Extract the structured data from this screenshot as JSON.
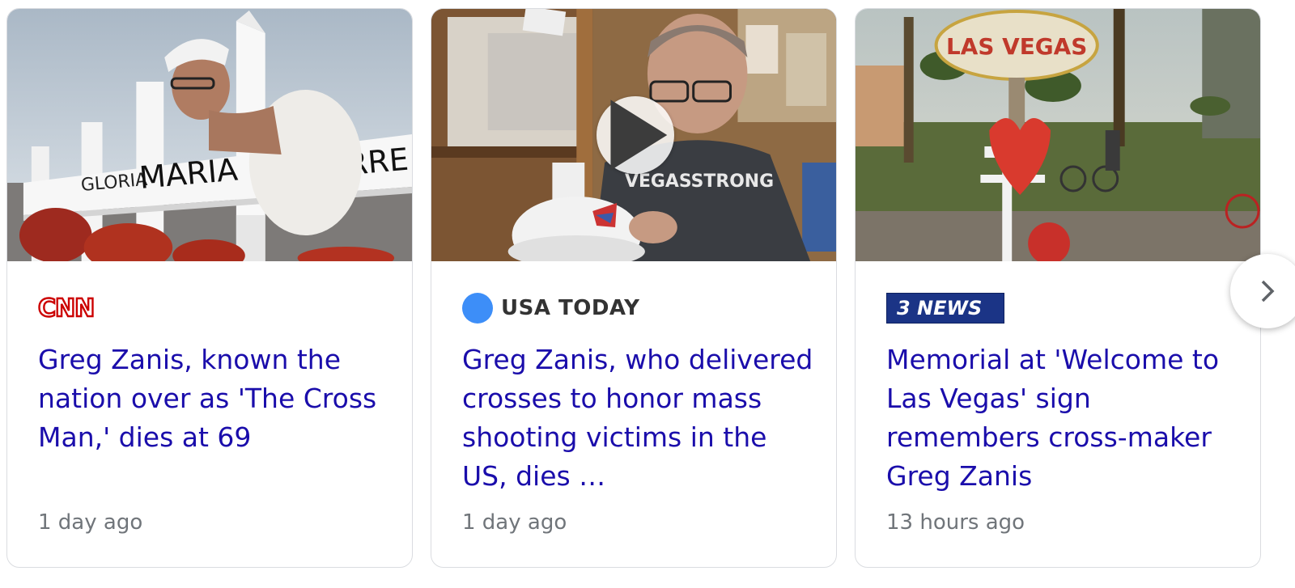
{
  "cards": [
    {
      "source": "CNN",
      "source_icon": "cnn-logo",
      "headline": "Greg Zanis, known the nation over as 'The Cross Man,' dies at 69",
      "time": "1 day ago",
      "image": "Man writing names on white memorial crosses",
      "cross_names": [
        "GLORIA",
        "MARIA",
        "LEGARRE"
      ]
    },
    {
      "source": "USA TODAY",
      "source_icon": "usa-today-dot",
      "headline": "Greg Zanis, who delivered crosses to honor mass shooting victims in the US, dies …",
      "time": "1 day ago",
      "image": "Man in VEGAS STRONG shirt holding a white hard hat",
      "shirt_text": "VEGASSTRONG",
      "video": true
    },
    {
      "source": "3 NEWS",
      "source_icon": "3news-logo",
      "headline": "Memorial at 'Welcome to Las Vegas' sign remembers cross-maker Greg Zanis",
      "time": "13 hours ago",
      "image": "Welcome to Las Vegas sign with red heart memorial cross",
      "sign_text": "LAS VEGAS"
    }
  ],
  "colors": {
    "headline": "#1a0dab",
    "meta": "#70757a",
    "cnn_red": "#cc0000",
    "usa_blue": "#3d8ef8",
    "news3_blue": "#1b3486"
  },
  "icons": {
    "play": "play-icon",
    "next": "chevron-right-icon"
  }
}
